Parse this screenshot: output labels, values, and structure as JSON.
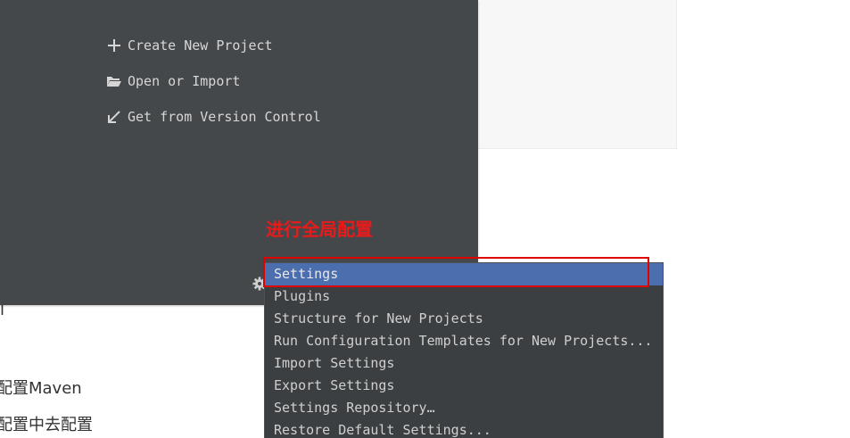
{
  "welcome": {
    "actions": [
      {
        "icon": "plus-icon",
        "label": "Create New Project"
      },
      {
        "icon": "folder-open-icon",
        "label": "Open or Import"
      },
      {
        "icon": "arrow-down-left-icon",
        "label": "Get from Version Control"
      }
    ],
    "settings_icon": "gear-icon"
  },
  "annotation": {
    "label": "进行全局配置",
    "color": "#e81a1a"
  },
  "menu": {
    "items": [
      "Settings",
      "Plugins",
      "Structure for New Projects",
      "Run Configuration Templates for New Projects...",
      "Import Settings",
      "Export Settings",
      "Settings Repository…",
      "Restore Default Settings..."
    ],
    "selected": "Settings",
    "selected_color": "#4b6eaf"
  },
  "background_text": {
    "line1": "l",
    "line2": "配置Maven",
    "line3": "配置中去配置"
  },
  "colors": {
    "welcome_bg": "#45484a",
    "menu_bg": "#3c3f41"
  }
}
